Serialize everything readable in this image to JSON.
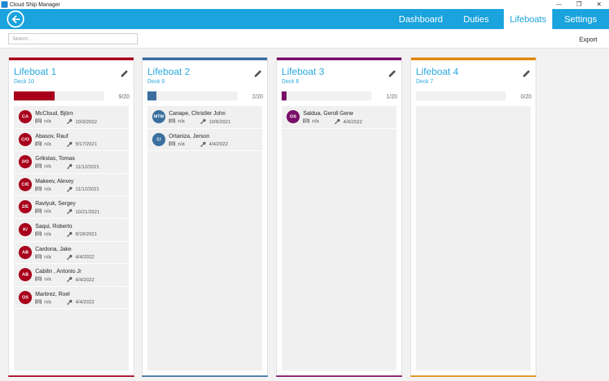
{
  "window": {
    "title": "Cloud Ship Manager",
    "controls": [
      "—",
      "❐",
      "✕"
    ]
  },
  "nav": {
    "items": [
      {
        "label": "Dashboard",
        "active": false
      },
      {
        "label": "Duties",
        "active": false
      },
      {
        "label": "Lifeboats",
        "active": true
      },
      {
        "label": "Settings",
        "active": false
      }
    ]
  },
  "toolbar": {
    "search_placeholder": "Search ...",
    "export_label": "Export"
  },
  "lifeboats": [
    {
      "title": "Lifeboat 1",
      "deck": "Deck 10",
      "count": "9/20",
      "fill": 0.45,
      "color": "#a8001c",
      "crew": [
        {
          "initials": "CA",
          "name": "McCloud, Björn",
          "cabin": "n/a",
          "date": "10/3/2022"
        },
        {
          "initials": "C/O",
          "name": "Abasov, Rauf",
          "cabin": "n/a",
          "date": "9/17/2021"
        },
        {
          "initials": "2/O",
          "name": "Grikstas, Tomas",
          "cabin": "n/a",
          "date": "11/12/2021"
        },
        {
          "initials": "C/E",
          "name": "Makeev, Alexey",
          "cabin": "n/a",
          "date": "11/12/2021"
        },
        {
          "initials": "2/E",
          "name": "Ravlyuk, Sergey",
          "cabin": "n/a",
          "date": "10/21/2021"
        },
        {
          "initials": "K/",
          "name": "Saqui, Roberto",
          "cabin": "n/a",
          "date": "8/16/2021"
        },
        {
          "initials": "AB",
          "name": "Cardona, Jake",
          "cabin": "n/a",
          "date": "4/4/2022"
        },
        {
          "initials": "AB",
          "name": "Cabilin , Antonio Jr",
          "cabin": "n/a",
          "date": "4/4/2022"
        },
        {
          "initials": "OS",
          "name": "Martirez, Roel",
          "cabin": "n/a",
          "date": "4/4/2022"
        }
      ]
    },
    {
      "title": "Lifeboat 2",
      "deck": "Deck 9",
      "count": "2/20",
      "fill": 0.1,
      "color": "#3a6f9e",
      "crew": [
        {
          "initials": "MTM",
          "name": "Canape, Christler John",
          "cabin": "n/a",
          "date": "10/6/2021"
        },
        {
          "initials": "C/",
          "name": "Ortaniza, Jerson",
          "cabin": "n/a",
          "date": "4/4/2022"
        }
      ]
    },
    {
      "title": "Lifeboat 3",
      "deck": "Deck 8",
      "count": "1/20",
      "fill": 0.05,
      "color": "#7a0f6a",
      "crew": [
        {
          "initials": "OS",
          "name": "Saldua, Geroll Gene",
          "cabin": "n/a",
          "date": "4/4/2022"
        }
      ]
    },
    {
      "title": "Lifeboat 4",
      "deck": "Deck 7",
      "count": "0/20",
      "fill": 0,
      "color": "#e38a10",
      "crew": []
    }
  ],
  "colors": {
    "header": "#1aa3dd",
    "title_text": "#2aa8df"
  }
}
